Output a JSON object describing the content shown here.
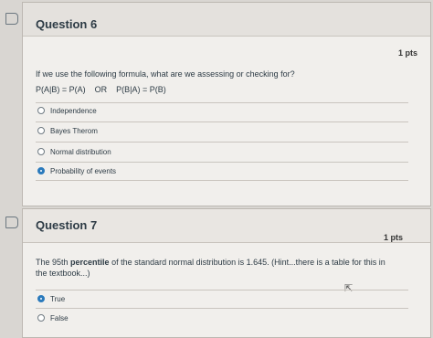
{
  "question6": {
    "title": "Question 6",
    "points": "1 pts",
    "text": "If we use the following formula, what are we assessing or checking for?",
    "formula": "P(A|B) = P(A)    OR    P(B|A) = P(B)",
    "options": [
      {
        "label": "Independence",
        "selected": false
      },
      {
        "label": "Bayes Therom",
        "selected": false
      },
      {
        "label": "Normal distribution",
        "selected": false
      },
      {
        "label": "Probability of events",
        "selected": true
      }
    ]
  },
  "question7": {
    "title": "Question 7",
    "points": "1 pts",
    "text_prefix": "The 95th ",
    "text_bold": "percentile",
    "text_suffix": " of the standard normal distribution is 1.645. (Hint...there is a table for this in the textbook...)",
    "options": [
      {
        "label": "True",
        "selected": true
      },
      {
        "label": "False",
        "selected": false
      }
    ]
  },
  "colors": {
    "accent": "#2b7abc",
    "background": "#d9d6d2",
    "card": "#f1efec"
  },
  "icons": {
    "flag": "flag-icon",
    "cursor": "cursor-icon"
  }
}
